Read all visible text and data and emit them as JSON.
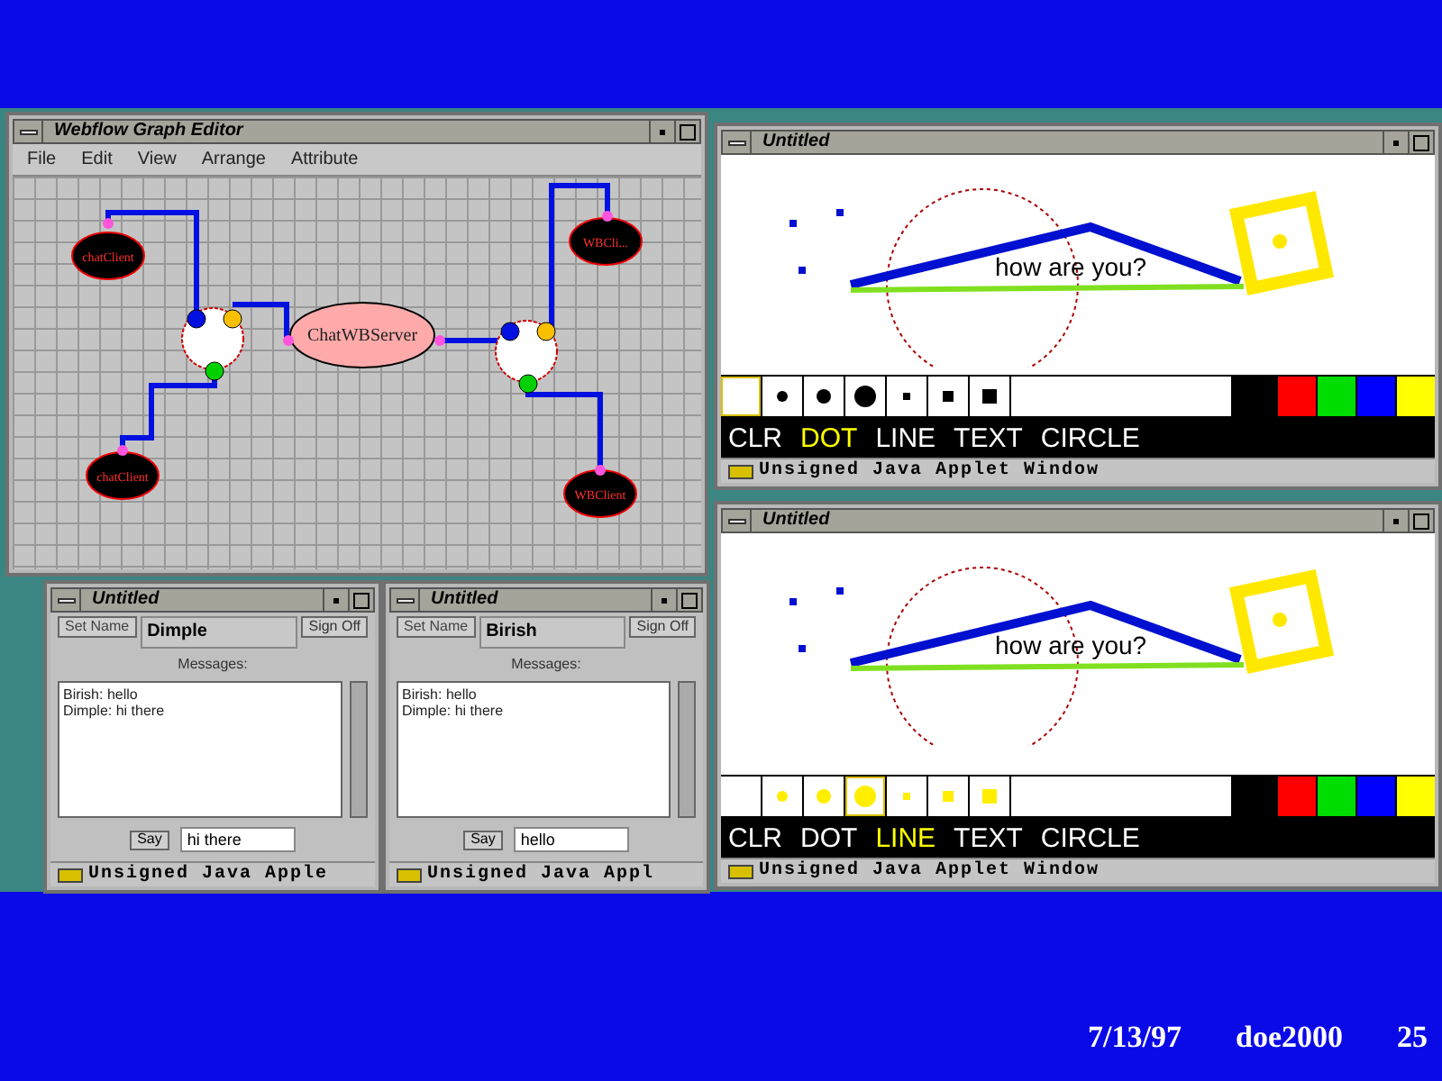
{
  "graph_editor": {
    "title": "Webflow Graph Editor",
    "menu": [
      "File",
      "Edit",
      "View",
      "Arrange",
      "Attribute"
    ],
    "nodes": [
      {
        "kind": "client",
        "label": "chatClient"
      },
      {
        "kind": "client",
        "label": "WBCli..."
      },
      {
        "kind": "server",
        "label": "ChatWBServer"
      },
      {
        "kind": "client",
        "label": "chatClient"
      },
      {
        "kind": "client",
        "label": "WBClient"
      }
    ]
  },
  "chat_windows": [
    {
      "title": "Untitled",
      "set_button": "Set Name",
      "name_value": "Dimple",
      "sign_button": "Sign Off",
      "messages_label": "Messages:",
      "messages": [
        "Birish: hello",
        "Dimple: hi there"
      ],
      "say_button": "Say",
      "input_value": "hi there",
      "status": "Unsigned Java Apple"
    },
    {
      "title": "Untitled",
      "set_button": "Set Name",
      "name_value": "Birish",
      "sign_button": "Sign Off",
      "messages_label": "Messages:",
      "messages": [
        "Birish: hello",
        "Dimple: hi there"
      ],
      "say_button": "Say",
      "input_value": "hello",
      "status": "Unsigned Java Appl"
    }
  ],
  "whiteboards": [
    {
      "title": "Untitled",
      "canvas_text": "how are you?",
      "tools": [
        {
          "selected": true
        },
        {
          "selected": false,
          "color": "#000000"
        },
        {
          "selected": false,
          "color": "#000000"
        },
        {
          "selected": false,
          "color": "#000000"
        },
        {
          "selected": false,
          "color": "#000000"
        },
        {
          "selected": false,
          "color": "#000000"
        },
        {
          "selected": false,
          "color": "#000000"
        }
      ],
      "palette": [
        {
          "color": "#ff0000"
        },
        {
          "color": "#00dd00"
        },
        {
          "color": "#0000ff"
        },
        {
          "color": "#ffff00"
        }
      ],
      "modes": [
        {
          "label": "CLR",
          "selected": false
        },
        {
          "label": "DOT",
          "selected": true
        },
        {
          "label": "LINE",
          "selected": false
        },
        {
          "label": "TEXT",
          "selected": false
        },
        {
          "label": "CIRCLE",
          "selected": false
        }
      ],
      "status": "Unsigned Java Applet Window"
    },
    {
      "title": "Untitled",
      "canvas_text": "how are you?",
      "tools": [
        {
          "selected": false
        },
        {
          "selected": false,
          "color": "#ffee00"
        },
        {
          "selected": false,
          "color": "#ffee00"
        },
        {
          "selected": true,
          "color": "#ffee00"
        },
        {
          "selected": false,
          "color": "#ffee00"
        },
        {
          "selected": false,
          "color": "#ffee00"
        },
        {
          "selected": false,
          "color": "#ffee00"
        }
      ],
      "palette": [
        {
          "color": "#ff0000"
        },
        {
          "color": "#00dd00"
        },
        {
          "color": "#0000ff"
        },
        {
          "color": "#ffff00"
        }
      ],
      "modes": [
        {
          "label": "CLR",
          "selected": false
        },
        {
          "label": "DOT",
          "selected": false
        },
        {
          "label": "LINE",
          "selected": true
        },
        {
          "label": "TEXT",
          "selected": false
        },
        {
          "label": "CIRCLE",
          "selected": false
        }
      ],
      "status": "Unsigned Java Applet Window"
    }
  ],
  "footer": {
    "date": "7/13/97",
    "project": "doe2000",
    "page": "25"
  }
}
